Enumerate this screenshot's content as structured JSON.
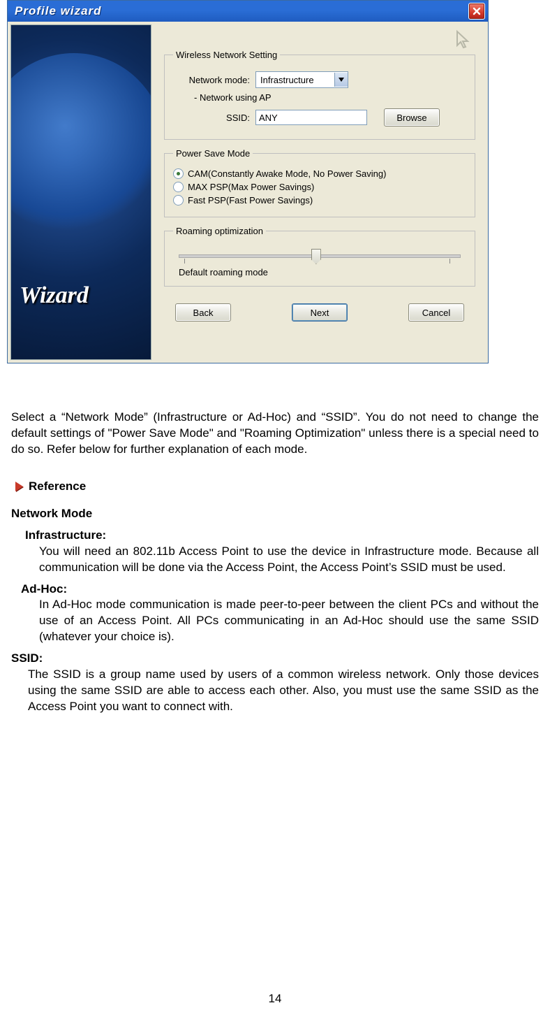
{
  "window": {
    "title": "Profile  wizard",
    "side_brand": "Wizard",
    "groups": {
      "wireless": {
        "legend": "Wireless Network Setting",
        "mode_label": "Network mode:",
        "mode_value": "Infrastructure",
        "using_ap": "- Network using AP",
        "ssid_label": "SSID:",
        "ssid_value": "ANY",
        "browse": "Browse"
      },
      "power": {
        "legend": "Power Save Mode",
        "options": [
          "CAM(Constantly Awake Mode, No Power Saving)",
          "MAX PSP(Max Power Savings)",
          "Fast PSP(Fast Power Savings)"
        ],
        "selected_index": 0
      },
      "roam": {
        "legend": "Roaming optimization",
        "mode_label": "Default roaming mode"
      }
    },
    "buttons": {
      "back": "Back",
      "next": "Next",
      "cancel": "Cancel"
    }
  },
  "article": {
    "intro": "Select a “Network Mode” (Infrastructure or Ad-Hoc) and “SSID”. You do not need to change the default  settings of \"Power Save Mode\" and \"Roaming Optimization\" unless there is a special need to do so. Refer below for further explanation of each mode.",
    "reference_heading": "Reference",
    "network_mode_heading": "Network Mode",
    "infra_term": "Infrastructure:",
    "infra_body": "You will need an 802.11b Access Point to use the device in Infrastructure mode. Because all communication will be done via the Access Point, the Access Point’s SSID must be used.",
    "adhoc_term": "Ad-Hoc:",
    "adhoc_body": "In Ad-Hoc mode communication is made peer-to-peer between the client PCs and without the use of an Access Point. All PCs communicating in an Ad-Hoc should use the same SSID (whatever your choice is).",
    "ssid_term": "SSID:",
    "ssid_body": "The SSID is a group name used by users of a common wireless network. Only those devices using the same SSID are able to access each other. Also, you must use the same SSID as the Access Point you want to connect with.",
    "page_number": "14"
  }
}
